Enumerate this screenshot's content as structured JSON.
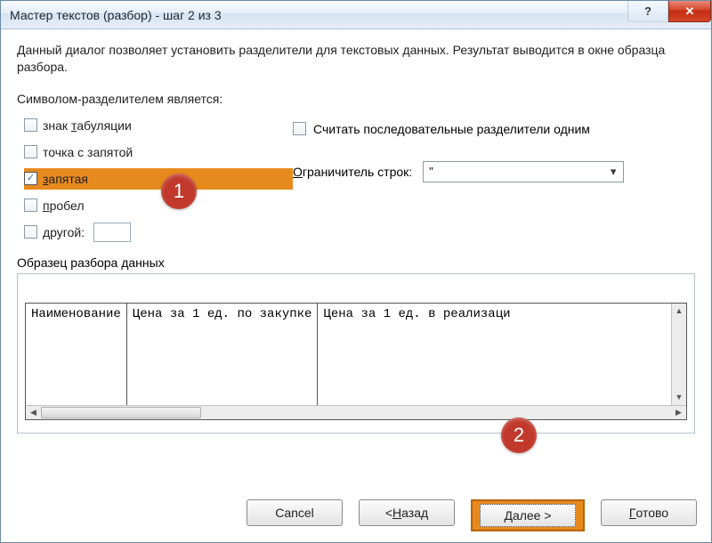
{
  "title": "Мастер текстов (разбор) - шаг 2 из 3",
  "titlebar": {
    "help_tooltip": "?",
    "close_tooltip": "✕"
  },
  "description": "Данный диалог позволяет установить разделители для текстовых данных. Результат выводится в окне образца разбора.",
  "delimiters": {
    "group_label": "Символом-разделителем является:",
    "tab": {
      "label": "знак табуляции",
      "checked": false
    },
    "semicolon": {
      "label": "точка с запятой",
      "checked": false
    },
    "comma": {
      "label": "запятая",
      "checked": true
    },
    "space": {
      "label": "пробел",
      "checked": false
    },
    "other": {
      "label": "другой:",
      "checked": false,
      "value": ""
    }
  },
  "consecutive": {
    "label": "Считать последовательные разделители одним",
    "checked": false
  },
  "qualifier": {
    "label": "Ограничитель строк:",
    "value": "\""
  },
  "preview": {
    "label": "Образец разбора данных",
    "columns": [
      "Наименование",
      "Цена за 1 ед. по закупке",
      "Цена за 1 ед. в реализаци"
    ]
  },
  "buttons": {
    "cancel": "Cancel",
    "back": "< Назад",
    "next": "Далее >",
    "finish": "Готово"
  },
  "callouts": {
    "one": "1",
    "two": "2"
  }
}
